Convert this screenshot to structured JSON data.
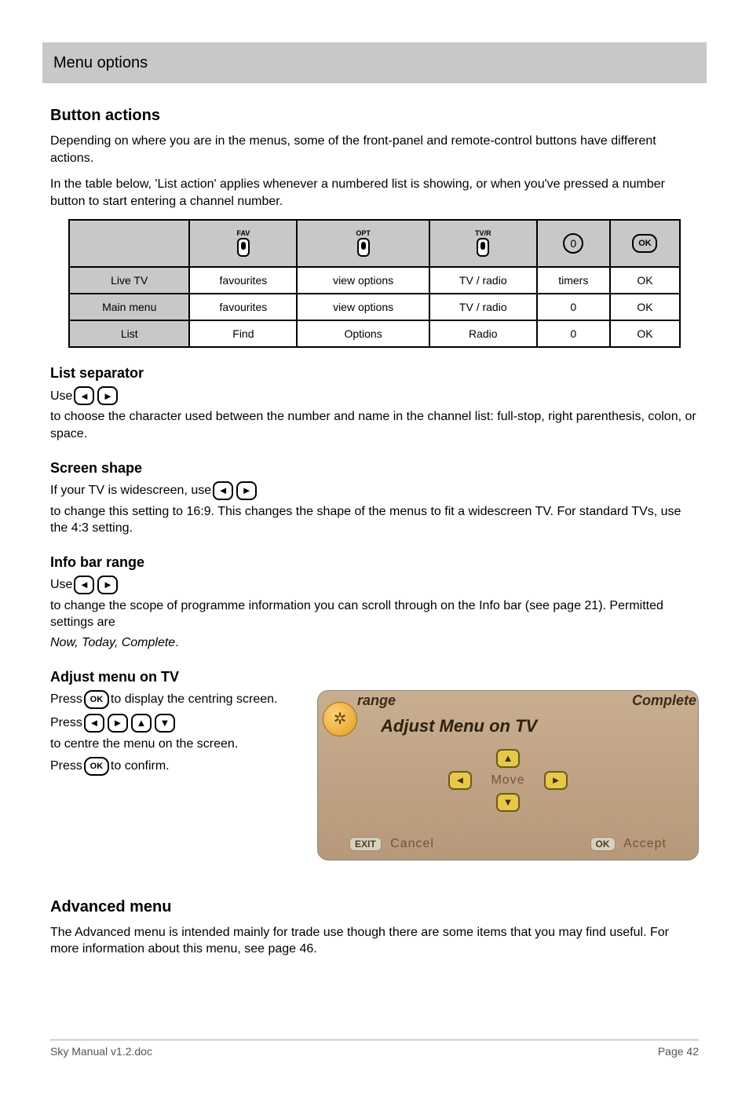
{
  "header": {
    "label": "Menu options"
  },
  "intro": {
    "h": "Button actions",
    "p1": "Depending on where you are in the menus, some of the front-panel and remote-control buttons have different actions.",
    "p2": "In the table below, 'List action' applies whenever a numbered list is showing, or when you've pressed a number button to start entering a channel number."
  },
  "table": {
    "head": [
      "",
      "FAV",
      "OPT",
      "TV/R",
      "0",
      "OK"
    ],
    "rows": [
      [
        "Live TV",
        "favourites",
        "view options",
        "TV / radio",
        "timers",
        "OK"
      ],
      [
        "Main menu",
        "favourites",
        "view options",
        "TV / radio",
        "0",
        "OK"
      ],
      [
        "List",
        "Find",
        "Options",
        "Radio",
        "0",
        "OK"
      ]
    ]
  },
  "keys": {
    "left": "◄",
    "right": "►",
    "up": "▲",
    "down": "▼",
    "ok": "OK",
    "zero": "0"
  },
  "sections": {
    "list_sep": {
      "t": "List separator",
      "pre": "Use ",
      "post": " to choose the character used between the number and name in the channel list: full-stop, right parenthesis, colon, or space."
    },
    "screen_shape": {
      "t": "Screen shape",
      "pre": "If your TV is widescreen, use ",
      "post": " to change this setting to 16:9. This changes the shape of the menus to fit a widescreen TV. For standard TVs, use the 4:3 setting."
    },
    "info_range": {
      "t": "Info bar range",
      "pre": "Use ",
      "mid": " to change the scope of programme information you can scroll through on the Info bar (see page 21). Permitted settings are ",
      "ital": "Now, Today, Complete",
      "end": "."
    },
    "adjust_menu": {
      "t": "Adjust menu on TV",
      "l1a": "Press ",
      "l1b": " to display the centring screen.",
      "l2a": "Press ",
      "l2b": " to centre the menu on the screen.",
      "l3a": "Press ",
      "l3b": " to confirm."
    }
  },
  "tv": {
    "top_left": "range",
    "top_right": "Complete",
    "title": "Adjust Menu on TV",
    "move": "Move",
    "exit": "EXIT",
    "cancel": "Cancel",
    "ok": "OK",
    "accept": "Accept"
  },
  "advanced": {
    "t": "Advanced menu",
    "p": "The Advanced menu is intended mainly for trade use though there are some items that you may find useful. For more information about this menu, see page 46."
  },
  "footer": {
    "left": "Sky Manual v1.2.doc",
    "right": "Page 42"
  }
}
